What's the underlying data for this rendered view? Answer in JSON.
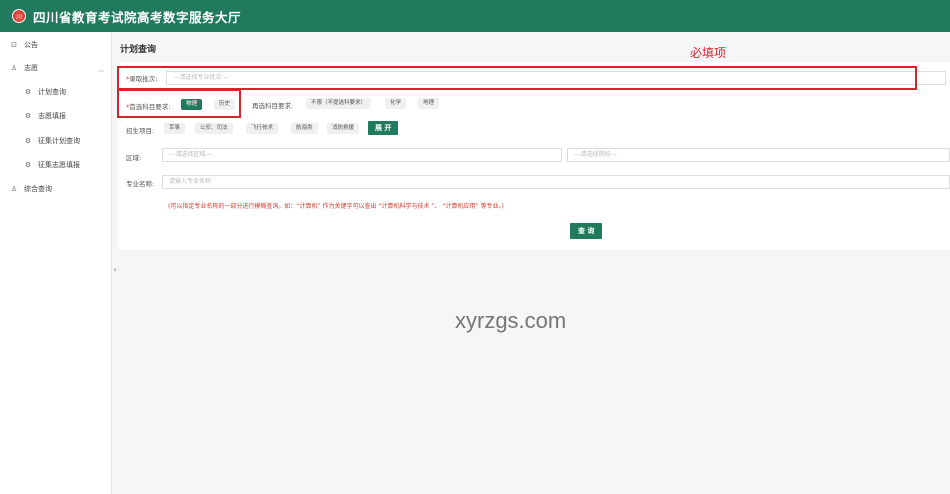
{
  "app": {
    "title": "四川省教育考试院高考数字服务大厅",
    "logo_text": "川"
  },
  "sidebar": {
    "items": [
      {
        "label": "公告",
        "icon": "notice-icon"
      },
      {
        "label": "志愿",
        "icon": "user-icon"
      },
      {
        "label": "计划查询",
        "icon": "gear-icon"
      },
      {
        "label": "志愿填报",
        "icon": "gear-icon"
      },
      {
        "label": "征集计划查询",
        "icon": "gear-icon"
      },
      {
        "label": "征集志愿填报",
        "icon": "gear-icon"
      },
      {
        "label": "综合查询",
        "icon": "user-icon"
      }
    ]
  },
  "page": {
    "title": "计划查询"
  },
  "form": {
    "batch": {
      "required_mark": "*",
      "label": "录取批次:",
      "placeholder": "---请选择专业批次---"
    },
    "first_subject": {
      "required_mark": "*",
      "label": "首选科目要求:",
      "options": [
        "物理",
        "历史"
      ],
      "selected": "物理"
    },
    "second_subject": {
      "label": "再选科目要求:",
      "options": [
        "不限（不提选科要求）",
        "化学",
        "地理"
      ]
    },
    "program": {
      "label": "招生项目:",
      "options": [
        "军事",
        "公安、司法",
        "飞行技术",
        "航海类",
        "消防救援"
      ],
      "expand_label": "展 开"
    },
    "region": {
      "label": "区域:",
      "placeholder": "---请选择区域---",
      "placeholder2": "---请选择院校---"
    },
    "major": {
      "label": "专业名称:",
      "placeholder": "请输入专业名称"
    },
    "hint": "(可以指定专业名称的一部分进行模糊查询。如：“计算机” 作为关键字可以查出 “计算机科学与技术 ”、 “计算机应用” 等专业。)"
  },
  "actions": {
    "query_label": "查 询"
  },
  "annotation": {
    "text": "必填项"
  },
  "watermark": "xyrzgs.com"
}
